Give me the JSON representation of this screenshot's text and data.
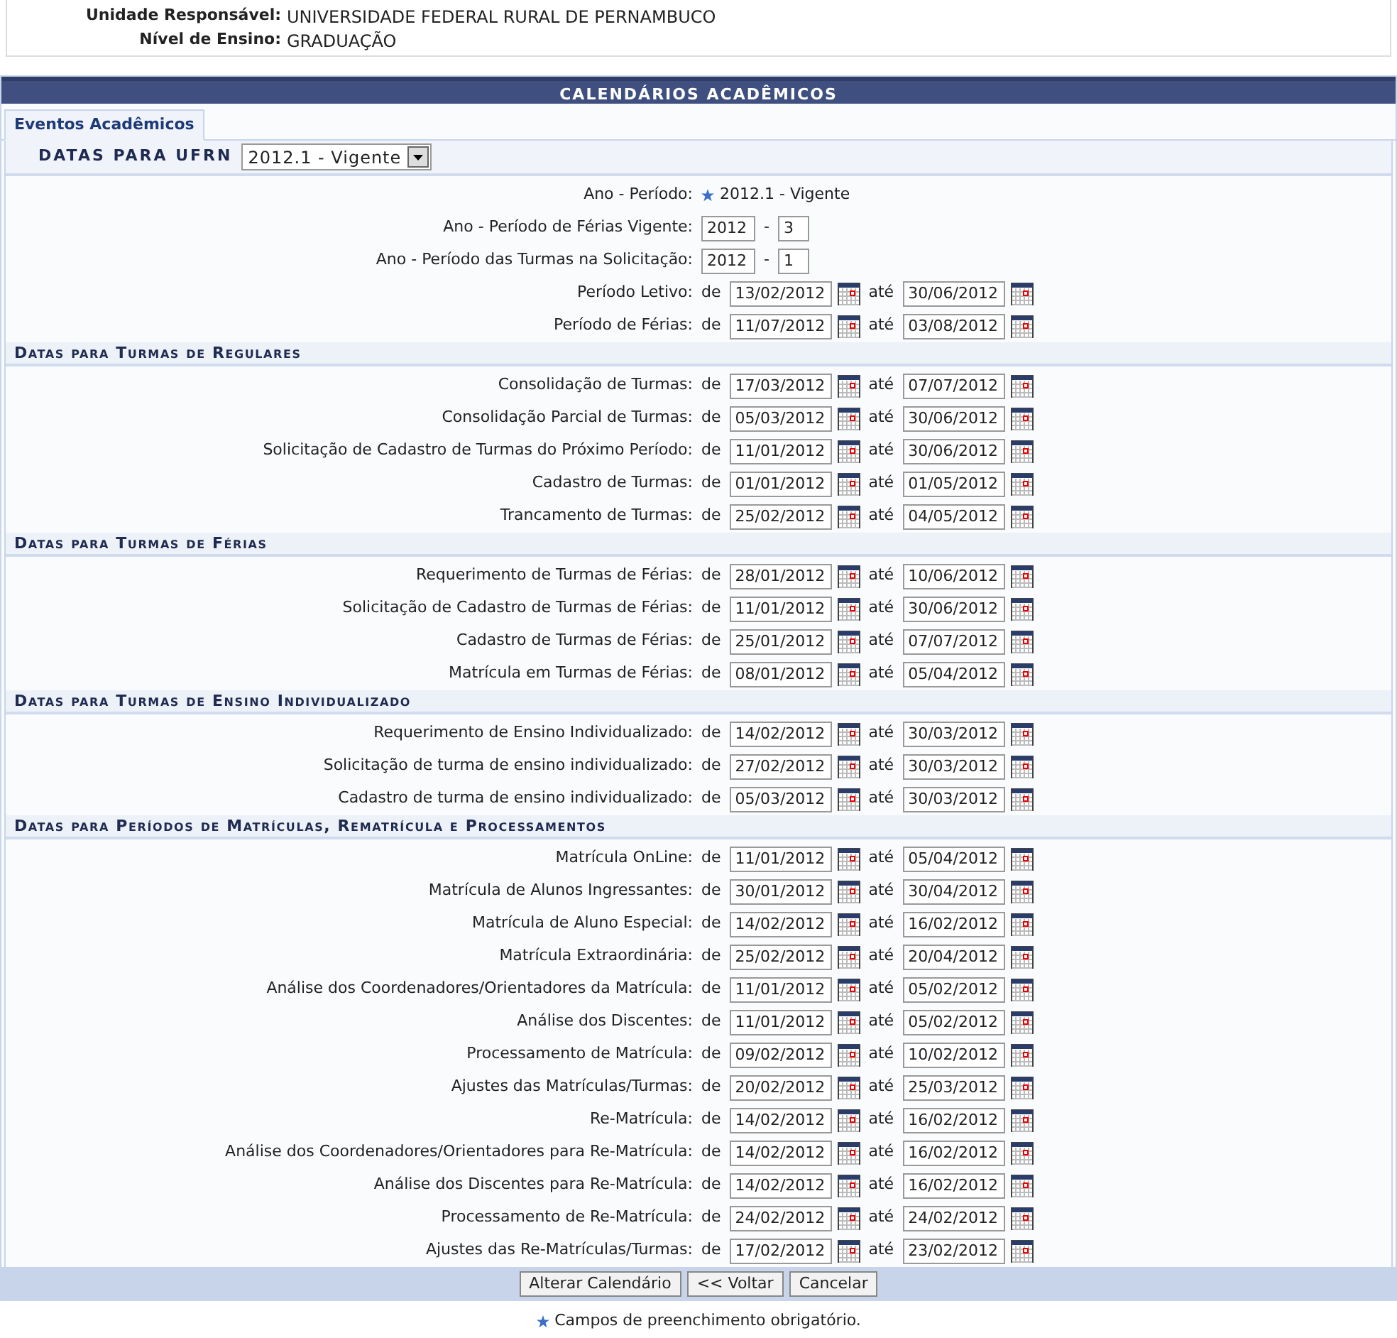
{
  "info": [
    {
      "label": "Unidade Responsável:",
      "value": "UNIVERSIDADE FEDERAL RURAL DE PERNAMBUCO"
    },
    {
      "label": "Nível de Ensino:",
      "value": "GRADUAÇÃO"
    }
  ],
  "panel_title": "CALENDÁRIOS ACADÊMICOS",
  "tabs": [
    {
      "label": "Eventos Acadêmicos",
      "selected": true
    }
  ],
  "calendar_select": {
    "label": "DATAS PARA UFRN",
    "value": "2012.1 - Vigente"
  },
  "sections": [
    {
      "rows": [
        {
          "kind": "text",
          "label": "Ano - Período:",
          "required": true,
          "value": "2012.1 - Vigente"
        },
        {
          "kind": "pair",
          "label": "Ano - Período de Férias Vigente:",
          "year": "2012",
          "separator": "-",
          "period": "3"
        },
        {
          "kind": "pair",
          "label": "Ano - Período das Turmas na Solicitação:",
          "year": "2012",
          "separator": "-",
          "period": "1"
        },
        {
          "kind": "range",
          "label": "Período Letivo:",
          "from_label": "de",
          "from": "13/02/2012",
          "to_label": "até",
          "to": "30/06/2012"
        },
        {
          "kind": "range",
          "label": "Período de Férias:",
          "from_label": "de",
          "from": "11/07/2012",
          "to_label": "até",
          "to": "03/08/2012"
        }
      ]
    },
    {
      "title": "Datas para Turmas de Regulares",
      "rows": [
        {
          "kind": "range",
          "label": "Consolidação de Turmas:",
          "from_label": "de",
          "from": "17/03/2012",
          "to_label": "até",
          "to": "07/07/2012"
        },
        {
          "kind": "range",
          "label": "Consolidação Parcial de Turmas:",
          "from_label": "de",
          "from": "05/03/2012",
          "to_label": "até",
          "to": "30/06/2012"
        },
        {
          "kind": "range",
          "label": "Solicitação de Cadastro de Turmas do Próximo Período:",
          "from_label": "de",
          "from": "11/01/2012",
          "to_label": "até",
          "to": "30/06/2012"
        },
        {
          "kind": "range",
          "label": "Cadastro de Turmas:",
          "from_label": "de",
          "from": "01/01/2012",
          "to_label": "até",
          "to": "01/05/2012"
        },
        {
          "kind": "range",
          "label": "Trancamento de Turmas:",
          "from_label": "de",
          "from": "25/02/2012",
          "to_label": "até",
          "to": "04/05/2012"
        }
      ]
    },
    {
      "title": "Datas para Turmas de Férias",
      "rows": [
        {
          "kind": "range",
          "label": "Requerimento de Turmas de Férias:",
          "from_label": "de",
          "from": "28/01/2012",
          "to_label": "até",
          "to": "10/06/2012"
        },
        {
          "kind": "range",
          "label": "Solicitação de Cadastro de Turmas de Férias:",
          "from_label": "de",
          "from": "11/01/2012",
          "to_label": "até",
          "to": "30/06/2012"
        },
        {
          "kind": "range",
          "label": "Cadastro de Turmas de Férias:",
          "from_label": "de",
          "from": "25/01/2012",
          "to_label": "até",
          "to": "07/07/2012"
        },
        {
          "kind": "range",
          "label": "Matrícula em Turmas de Férias:",
          "from_label": "de",
          "from": "08/01/2012",
          "to_label": "até",
          "to": "05/04/2012"
        }
      ]
    },
    {
      "title": "Datas para Turmas de Ensino Individualizado",
      "rows": [
        {
          "kind": "range",
          "label": "Requerimento de Ensino Individualizado:",
          "from_label": "de",
          "from": "14/02/2012",
          "to_label": "até",
          "to": "30/03/2012"
        },
        {
          "kind": "range",
          "label": "Solicitação de turma de ensino individualizado:",
          "from_label": "de",
          "from": "27/02/2012",
          "to_label": "até",
          "to": "30/03/2012"
        },
        {
          "kind": "range",
          "label": "Cadastro de turma de ensino individualizado:",
          "from_label": "de",
          "from": "05/03/2012",
          "to_label": "até",
          "to": "30/03/2012"
        }
      ]
    },
    {
      "title": "Datas para Períodos de Matrículas, Rematrícula e Processamentos",
      "rows": [
        {
          "kind": "range",
          "label": "Matrícula OnLine:",
          "from_label": "de",
          "from": "11/01/2012",
          "to_label": "até",
          "to": "05/04/2012"
        },
        {
          "kind": "range",
          "label": "Matrícula de Alunos Ingressantes:",
          "from_label": "de",
          "from": "30/01/2012",
          "to_label": "até",
          "to": "30/04/2012"
        },
        {
          "kind": "range",
          "label": "Matrícula de Aluno Especial:",
          "from_label": "de",
          "from": "14/02/2012",
          "to_label": "até",
          "to": "16/02/2012"
        },
        {
          "kind": "range",
          "label": "Matrícula Extraordinária:",
          "from_label": "de",
          "from": "25/02/2012",
          "to_label": "até",
          "to": "20/04/2012"
        },
        {
          "kind": "range",
          "label": "Análise dos Coordenadores/Orientadores da Matrícula:",
          "from_label": "de",
          "from": "11/01/2012",
          "to_label": "até",
          "to": "05/02/2012"
        },
        {
          "kind": "range",
          "label": "Análise dos Discentes:",
          "from_label": "de",
          "from": "11/01/2012",
          "to_label": "até",
          "to": "05/02/2012"
        },
        {
          "kind": "range",
          "label": "Processamento de Matrícula:",
          "from_label": "de",
          "from": "09/02/2012",
          "to_label": "até",
          "to": "10/02/2012"
        },
        {
          "kind": "range",
          "label": "Ajustes das Matrículas/Turmas:",
          "from_label": "de",
          "from": "20/02/2012",
          "to_label": "até",
          "to": "25/03/2012"
        },
        {
          "kind": "range",
          "label": "Re-Matrícula:",
          "from_label": "de",
          "from": "14/02/2012",
          "to_label": "até",
          "to": "16/02/2012"
        },
        {
          "kind": "range",
          "label": "Análise dos Coordenadores/Orientadores para Re-Matrícula:",
          "from_label": "de",
          "from": "14/02/2012",
          "to_label": "até",
          "to": "16/02/2012"
        },
        {
          "kind": "range",
          "label": "Análise dos Discentes para Re-Matrícula:",
          "from_label": "de",
          "from": "14/02/2012",
          "to_label": "até",
          "to": "16/02/2012"
        },
        {
          "kind": "range",
          "label": "Processamento de Re-Matrícula:",
          "from_label": "de",
          "from": "24/02/2012",
          "to_label": "até",
          "to": "24/02/2012"
        },
        {
          "kind": "range",
          "label": "Ajustes das Re-Matrículas/Turmas:",
          "from_label": "de",
          "from": "17/02/2012",
          "to_label": "até",
          "to": "23/02/2012"
        }
      ]
    }
  ],
  "buttons": [
    "Alterar Calendário",
    "<< Voltar",
    "Cancelar"
  ],
  "footnote": {
    "required": true,
    "text": "Campos de preenchimento obrigatório."
  }
}
